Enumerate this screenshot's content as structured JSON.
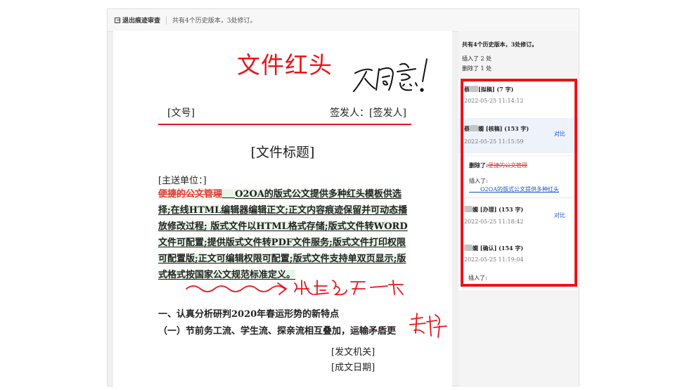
{
  "toolbar": {
    "exit_label": "退出痕迹审查",
    "summary": "共有4个历史版本，3处修订。",
    "exit_icon": "exit-icon"
  },
  "document": {
    "red_head": "文件红头",
    "handwriting_top": "不同意！",
    "doc_number": "[文号]",
    "signer": "签发人：[签发人]",
    "title": "[文件标题]",
    "recipient": "[主送单位：]",
    "deleted_text": "便捷的公文管理",
    "inserted_gap": "    ",
    "inserted_text": "O2OA的版式公文提供多种红头模板供选择;在线HTML编辑器编辑正文;正文内容痕迹保留并可动态播放修改过程;  版式文件以HTML格式存储;版式文件转WORD文件可配置;提供版式文件转PDF文件服务;版式文件打印权限可配置版;正文可编辑权限可配置;版式文件支持单双页显示;版式格式按国家公文规范标准定义。",
    "handwriting_middle": "这里多空一行",
    "heading1": "一、认真分析研判2020年春运形势的新特点",
    "heading2_prefix": "（一）节前务工流、学生流、探亲流相互叠加，",
    "heading2_struck": "运输矛盾更",
    "handwriting_right": "去掉",
    "issuer": "[发文机关]",
    "date": "[成文日期]"
  },
  "sidebar": {
    "summary": "共有4个历史版本，3处修订。",
    "inserted_count": "插入了 2 处",
    "deleted_count": "删除了 1 处",
    "compare_label": "对比",
    "versions": [
      {
        "name_suffix": "蔡",
        "title": "[拟稿] (7 字)",
        "time": "2022-05-25 11:14:12"
      },
      {
        "name_suffix": "蔡",
        "title": "嫺 [核稿] (153 字)",
        "time": "2022-05-25 11:15:59"
      },
      {
        "name_suffix": "",
        "title": "嫺 [办理] (153 字)",
        "time": "2022-05-25 11:18:42"
      },
      {
        "name_suffix": "",
        "title": "嫺 [确认] (154 字)",
        "time": "2022-05-25 11:19:04"
      }
    ],
    "diff": {
      "deleted_label": "删除了:",
      "deleted_text": "便捷的公文管理",
      "inserted_label": "插入了:",
      "inserted_text": "____O2OA的版式公文提供多种红头"
    },
    "last_inserted_label": "插入了:"
  },
  "colors": {
    "accent_red": "#e8141c",
    "link_blue": "#1a56c7",
    "highlight_green": "#e8f6e8"
  }
}
